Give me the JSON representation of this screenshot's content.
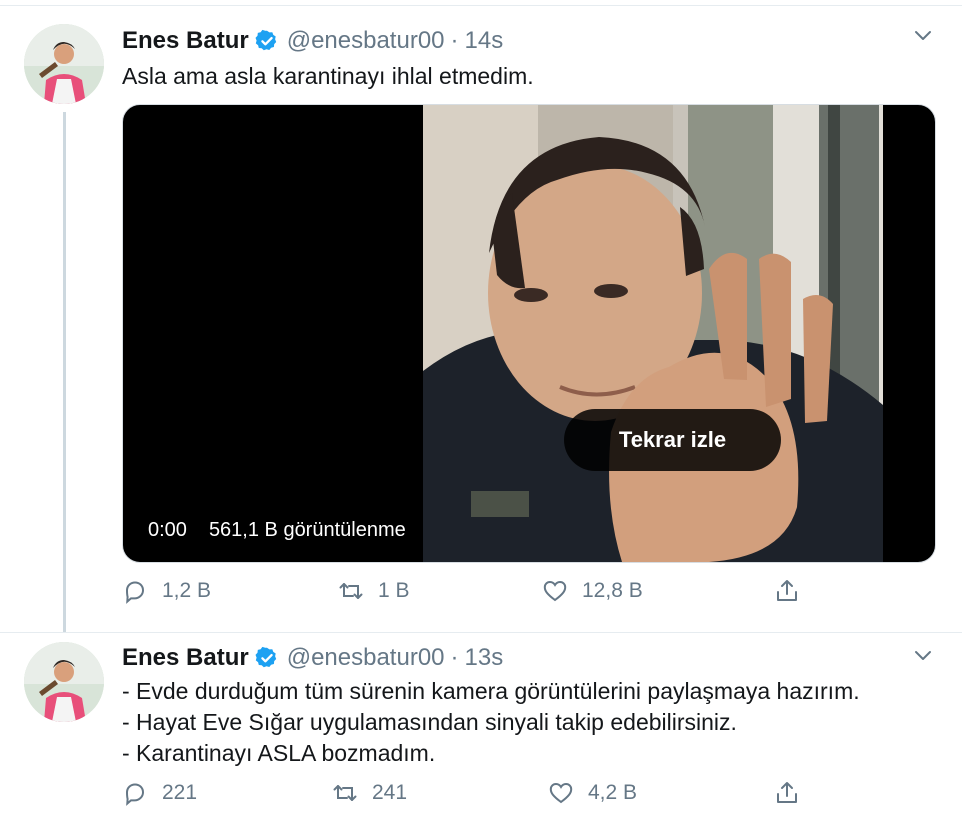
{
  "tweets": [
    {
      "display_name": "Enes Batur",
      "handle": "@enesbatur00",
      "separator": "·",
      "time": "14s",
      "text_lines": [
        "Asla ama asla karantinayı ihlal etmedim."
      ],
      "video": {
        "replay_label": "Tekrar izle",
        "timestamp": "0:00",
        "views": "561,1 B görüntülenme"
      },
      "actions": {
        "replies": "1,2 B",
        "retweets": "1 B",
        "likes": "12,8 B"
      }
    },
    {
      "display_name": "Enes Batur",
      "handle": "@enesbatur00",
      "separator": "·",
      "time": "13s",
      "text_lines": [
        "- Evde durduğum tüm sürenin kamera görüntülerini paylaşmaya hazırım.",
        "- Hayat Eve Sığar uygulamasından sinyali takip edebilirsiniz.",
        "- Karantinayı ASLA bozmadım."
      ],
      "actions": {
        "replies": "221",
        "retweets": "241",
        "likes": "4,2 B"
      }
    }
  ],
  "icons": {
    "verified": "verified-badge-icon",
    "menu": "chevron-down-icon",
    "reply": "reply-icon",
    "retweet": "retweet-icon",
    "like": "heart-icon",
    "share": "share-icon"
  },
  "colors": {
    "accent": "#1da1f2",
    "muted": "#657786",
    "text": "#14171a"
  }
}
